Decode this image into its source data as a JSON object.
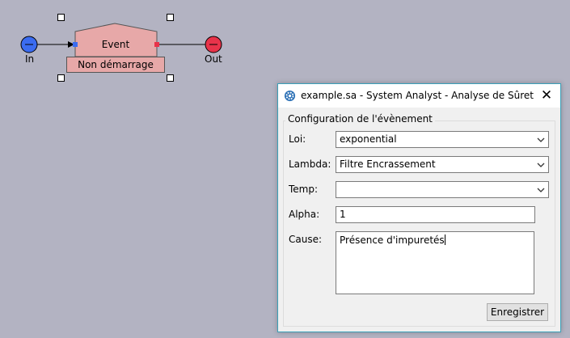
{
  "canvas": {
    "background_color": "#b3b3c2",
    "in_port": {
      "label": "In",
      "color": "#3b6cf0"
    },
    "out_port": {
      "label": "Out",
      "color": "#e8334a"
    },
    "event_block": {
      "title": "Event",
      "subtitle": "Non démarrage",
      "fill_color": "#e7a8a8"
    }
  },
  "dialog": {
    "title": "example.sa - System Analyst - Analyse de Sûreté de f...",
    "app_icon": "gear-icon",
    "close_icon": "close-icon",
    "group_title": "Configuration de l'évènement",
    "fields": {
      "loi": {
        "label": "Loi:",
        "value": "exponential"
      },
      "lambda": {
        "label": "Lambda:",
        "value": "Filtre Encrassement"
      },
      "temp": {
        "label": "Temp:",
        "value": ""
      },
      "alpha": {
        "label": "Alpha:",
        "value": "1"
      },
      "cause": {
        "label": "Cause:",
        "value": "Présence d'impuretés"
      }
    },
    "save_label": "Enregistrer",
    "border_color": "#3aa0b8"
  }
}
